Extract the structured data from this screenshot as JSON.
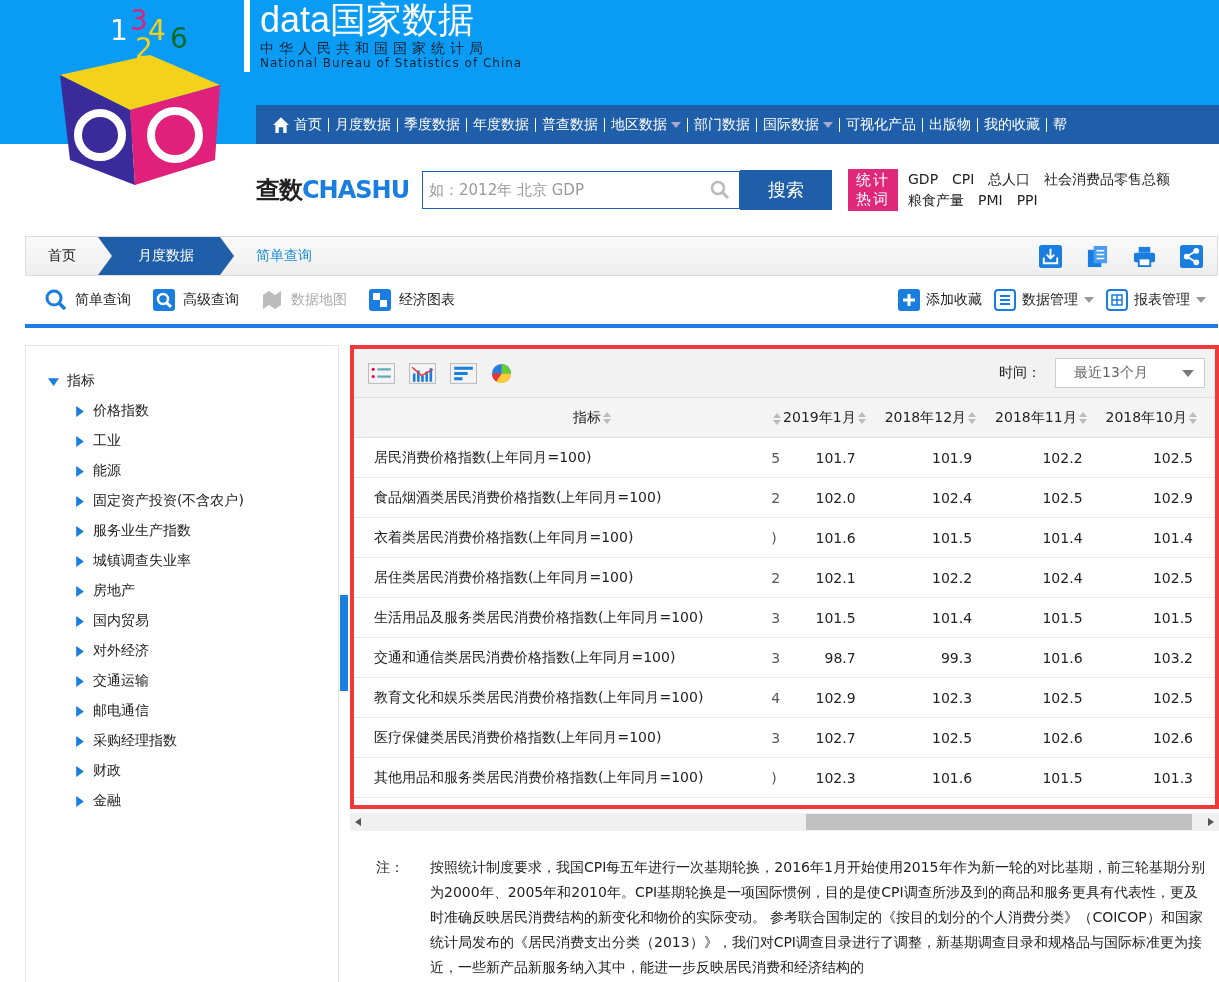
{
  "header": {
    "cube_digits": [
      "1",
      "3",
      "4",
      "2",
      "6"
    ],
    "logo_text": "data国家数据",
    "org_cn": "中华人民共和国国家统计局",
    "org_en": "National Bureau of Statistics of China"
  },
  "nav": [
    {
      "label": "首页",
      "kind": "home",
      "dropdown": false
    },
    {
      "label": "月度数据",
      "kind": "plain",
      "dropdown": false
    },
    {
      "label": "季度数据",
      "kind": "plain",
      "dropdown": false
    },
    {
      "label": "年度数据",
      "kind": "plain",
      "dropdown": false
    },
    {
      "label": "普查数据",
      "kind": "plain",
      "dropdown": false
    },
    {
      "label": "地区数据",
      "kind": "plain",
      "dropdown": true
    },
    {
      "label": "部门数据",
      "kind": "plain",
      "dropdown": false
    },
    {
      "label": "国际数据",
      "kind": "plain",
      "dropdown": true
    },
    {
      "label": "可视化产品",
      "kind": "plain",
      "dropdown": false
    },
    {
      "label": "出版物",
      "kind": "plain",
      "dropdown": false
    },
    {
      "label": "我的收藏",
      "kind": "plain",
      "dropdown": false
    },
    {
      "label": "帮",
      "kind": "plain",
      "dropdown": false
    }
  ],
  "search": {
    "brand_a": "查数",
    "brand_b": "CHASHU",
    "placeholder": "如：2012年 北京 GDP",
    "button": "搜索",
    "hot_label": "统计热词",
    "hot_words": [
      [
        "GDP",
        "CPI",
        "总人口",
        "社会消费品零售总额"
      ],
      [
        "粮食产量",
        "PMI",
        "PPI"
      ]
    ]
  },
  "breadcrumb": [
    {
      "label": "首页",
      "selected": false
    },
    {
      "label": "月度数据",
      "selected": true
    },
    {
      "label": "简单查询",
      "selected": false
    }
  ],
  "query_tabs": [
    {
      "label": "简单查询",
      "kind": "search",
      "disabled": false
    },
    {
      "label": "高级查询",
      "kind": "advanced",
      "disabled": false
    },
    {
      "label": "数据地图",
      "kind": "map",
      "disabled": true
    },
    {
      "label": "经济图表",
      "kind": "chart",
      "disabled": false
    }
  ],
  "actions": [
    {
      "label": "添加收藏",
      "kind": "plus",
      "dropdown": false
    },
    {
      "label": "数据管理",
      "kind": "list",
      "dropdown": true
    },
    {
      "label": "报表管理",
      "kind": "grid",
      "dropdown": true
    }
  ],
  "sidebar": {
    "items": [
      {
        "label": "指标",
        "expanded": true,
        "children": [
          {
            "label": "价格指数",
            "expanded": false
          },
          {
            "label": "工业",
            "expanded": false
          },
          {
            "label": "能源",
            "expanded": false
          },
          {
            "label": "固定资产投资(不含农户)",
            "expanded": false
          },
          {
            "label": "服务业生产指数",
            "expanded": false
          },
          {
            "label": "城镇调查失业率",
            "expanded": false
          },
          {
            "label": "房地产",
            "expanded": false
          },
          {
            "label": "国内贸易",
            "expanded": false
          },
          {
            "label": "对外经济",
            "expanded": false
          },
          {
            "label": "交通运输",
            "expanded": false
          },
          {
            "label": "邮电通信",
            "expanded": false
          },
          {
            "label": "采购经理指数",
            "expanded": false
          },
          {
            "label": "财政",
            "expanded": false
          },
          {
            "label": "金融",
            "expanded": false
          }
        ]
      }
    ]
  },
  "time_filter": {
    "label": "时间：",
    "value": "最近13个月"
  },
  "table": {
    "columns": [
      "指标",
      "",
      "2019年1月",
      "2018年12月",
      "2018年11月",
      "2018年10月"
    ],
    "rows": [
      [
        "居民消费价格指数(上年同月=100)",
        "5",
        "101.7",
        "101.9",
        "102.2",
        "102.5"
      ],
      [
        "食品烟酒类居民消费价格指数(上年同月=100)",
        "2",
        "102.0",
        "102.4",
        "102.5",
        "102.9"
      ],
      [
        "衣着类居民消费价格指数(上年同月=100)",
        ")",
        "101.6",
        "101.5",
        "101.4",
        "101.4"
      ],
      [
        "居住类居民消费价格指数(上年同月=100)",
        "2",
        "102.1",
        "102.2",
        "102.4",
        "102.5"
      ],
      [
        "生活用品及服务类居民消费价格指数(上年同月=100)",
        "3",
        "101.5",
        "101.4",
        "101.5",
        "101.5"
      ],
      [
        "交通和通信类居民消费价格指数(上年同月=100)",
        "3",
        "98.7",
        "99.3",
        "101.6",
        "103.2"
      ],
      [
        "教育文化和娱乐类居民消费价格指数(上年同月=100)",
        "4",
        "102.9",
        "102.3",
        "102.5",
        "102.5"
      ],
      [
        "医疗保健类居民消费价格指数(上年同月=100)",
        "3",
        "102.7",
        "102.5",
        "102.6",
        "102.6"
      ],
      [
        "其他用品和服务类居民消费价格指数(上年同月=100)",
        ")",
        "102.3",
        "101.6",
        "101.5",
        "101.3"
      ]
    ]
  },
  "note": {
    "label": "注：",
    "text": "按照统计制度要求，我国CPI每五年进行一次基期轮换，2016年1月开始使用2015年作为新一轮的对比基期，前三轮基期分别为2000年、2005年和2010年。CPI基期轮换是一项国际惯例，目的是使CPI调查所涉及到的商品和服务更具有代表性，更及时准确反映居民消费结构的新变化和物价的实际变动。 参考联合国制定的《按目的划分的个人消费分类》（COICOP）和国家统计局发布的《居民消费支出分类（2013）》，我们对CPI调查目录进行了调整，新基期调查目录和规格品与国际标准更为接近，一些新产品新服务纳入其中，能进一步反映居民消费和经济结构的"
  }
}
